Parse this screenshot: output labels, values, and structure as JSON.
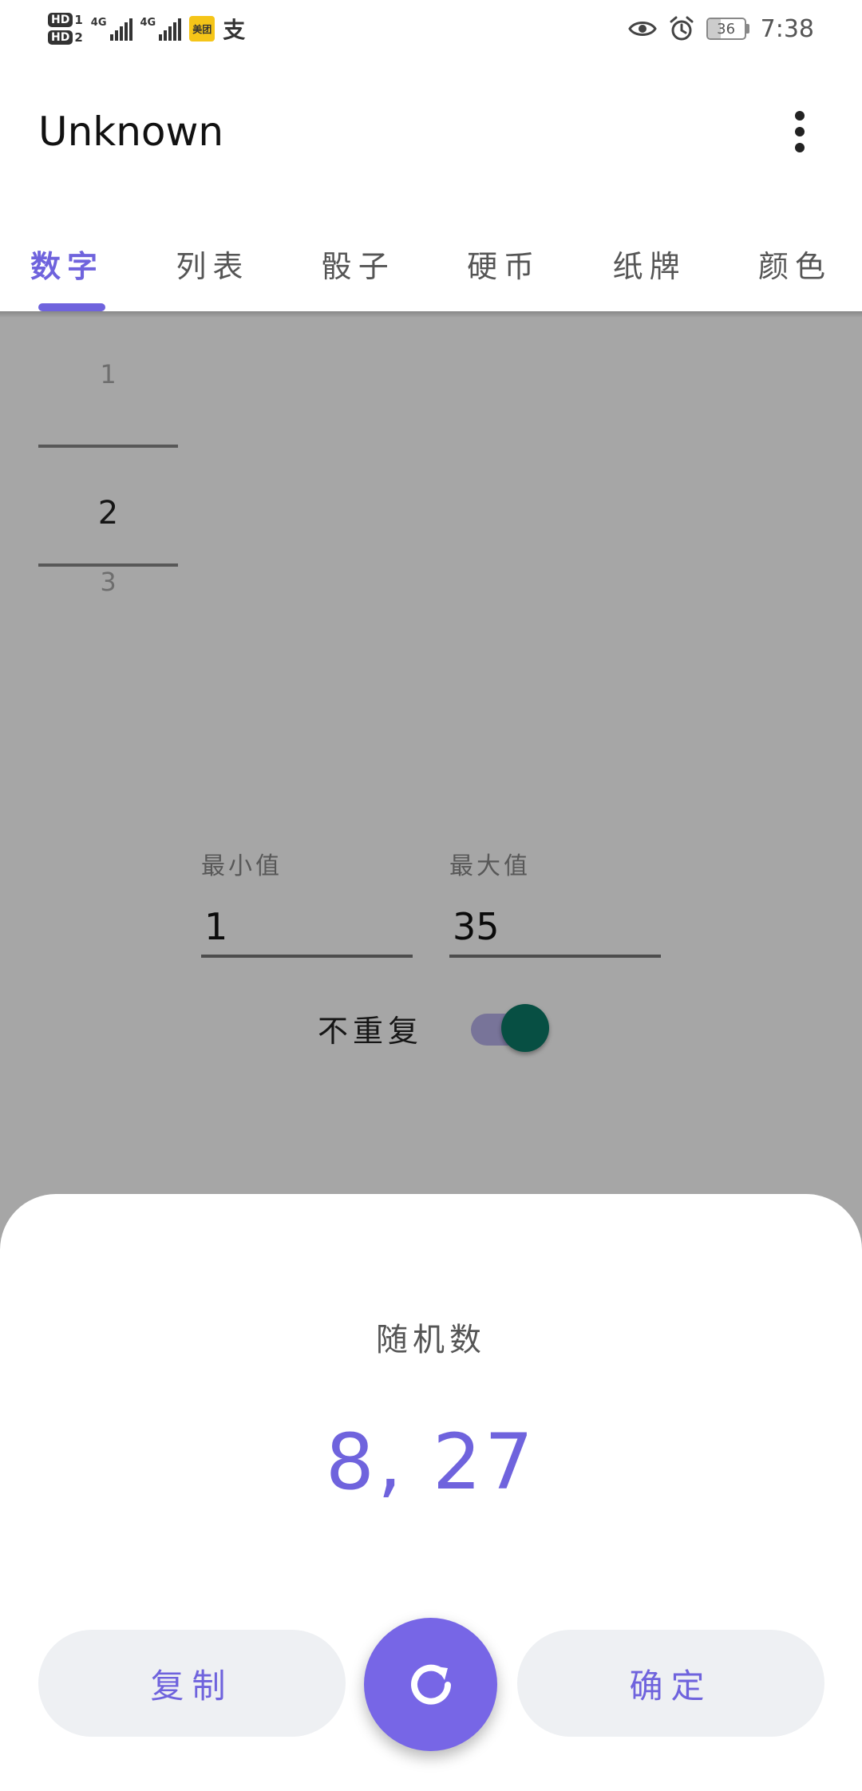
{
  "status_bar": {
    "sim1_label": "HD",
    "sim1_index": "1",
    "sim2_label": "HD",
    "sim2_index": "2",
    "network1": "4G",
    "network2": "4G",
    "app_badge": "美团",
    "alipay_glyph": "支",
    "battery": "36",
    "battery_level": 0.36,
    "time": "7:38",
    "icons": [
      "eye-icon",
      "alarm-icon",
      "battery-icon"
    ]
  },
  "app_bar": {
    "title": "Unknown",
    "overflow_icon": "more-vert-icon"
  },
  "tabs": [
    {
      "label": "数字",
      "active": true
    },
    {
      "label": "列表",
      "active": false
    },
    {
      "label": "骰子",
      "active": false
    },
    {
      "label": "硬币",
      "active": false
    },
    {
      "label": "纸牌",
      "active": false
    },
    {
      "label": "颜色",
      "active": false
    }
  ],
  "picker": {
    "prev": "1",
    "current": "2",
    "next": "3"
  },
  "range": {
    "min_label": "最小值",
    "min_value": "1",
    "max_label": "最大值",
    "max_value": "35"
  },
  "no_repeat": {
    "label": "不重复",
    "enabled": true
  },
  "sheet": {
    "title": "随机数",
    "result": "8, 27",
    "copy_label": "复制",
    "refresh_icon": "refresh-icon",
    "confirm_label": "确定"
  },
  "colors": {
    "accent": "#6f63dd",
    "fab": "#7766e6",
    "switch_thumb": "#0b7a67",
    "pill_bg": "#eef0f3"
  }
}
